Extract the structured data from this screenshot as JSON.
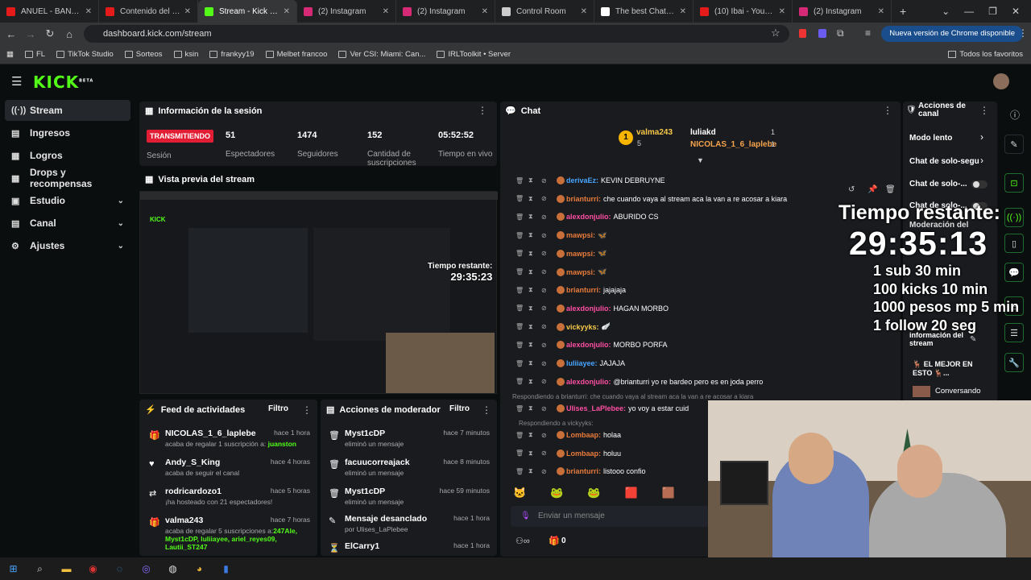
{
  "browser": {
    "tabs": [
      {
        "title": "ANUEL - BANDOL",
        "color": "#e51b1b"
      },
      {
        "title": "Contenido del canal",
        "color": "#e51b1b"
      },
      {
        "title": "Stream - Kick Dashbo",
        "color": "#53fc18",
        "active": true
      },
      {
        "title": "(2) Instagram",
        "color": "#d62976"
      },
      {
        "title": "(2) Instagram",
        "color": "#d62976"
      },
      {
        "title": "Control Room",
        "color": "#cccccc"
      },
      {
        "title": "The best ChatBot an",
        "color": "#ffffff"
      },
      {
        "title": "(10) Ibai - YouTube",
        "color": "#e51b1b"
      },
      {
        "title": "(2) Instagram",
        "color": "#d62976"
      }
    ],
    "url": "dashboard.kick.com/stream",
    "update_button": "Nueva versión de Chrome disponible",
    "bookmarks": [
      "FL",
      "TikTok Studio",
      "Sorteos",
      "ksin",
      "frankyy19",
      "Melbet francoo",
      "Ver CSI: Miami: Can...",
      "IRLToolkit • Server"
    ],
    "bookmarks_right": "Todos los favoritos"
  },
  "logo": "KICK",
  "logo_beta": "BETA",
  "sidebar": [
    {
      "label": "Stream",
      "icon": "stream-icon"
    },
    {
      "label": "Ingresos",
      "icon": "ingresos-icon"
    },
    {
      "label": "Logros",
      "icon": "logros-icon"
    },
    {
      "label": "Drops y recompensas",
      "icon": "drops-icon"
    },
    {
      "label": "Estudio",
      "icon": "estudio-icon"
    },
    {
      "label": "Canal",
      "icon": "canal-icon"
    },
    {
      "label": "Ajustes",
      "icon": "ajustes-icon"
    }
  ],
  "session": {
    "title": "Información de la sesión",
    "live_badge": "TRANSMITIENDO",
    "live_label": "Sesión",
    "stats": [
      {
        "value": "51",
        "label": "Espectadores"
      },
      {
        "value": "1474",
        "label": "Seguidores"
      },
      {
        "value": "152",
        "label": "Cantidad de suscripciones"
      },
      {
        "value": "05:52:52",
        "label": "Tiempo en vivo"
      }
    ]
  },
  "preview": {
    "title": "Vista previa del stream"
  },
  "feed": {
    "title": "Feed de actividades",
    "filter": "Filtro",
    "items": [
      {
        "name": "NICOLAS_1_6_laplebe",
        "time": "hace 1 hora",
        "text": "acaba de regalar 1 suscripción a: ",
        "highlight": "juanston"
      },
      {
        "name": "Andy_S_King",
        "time": "hace 4 horas",
        "text": "acaba de seguir el canal",
        "highlight": ""
      },
      {
        "name": "rodricardozo1",
        "time": "hace 5 horas",
        "text": "¡ha hosteado con 21 espectadores!",
        "highlight": ""
      },
      {
        "name": "valma243",
        "time": "hace 7 horas",
        "text": "acaba de regalar 5 suscripciones a:",
        "highlight": "247Ale, Myst1cDP, luliiayee, ariel_reyes09, Lautii_ST247"
      }
    ]
  },
  "mod_actions": {
    "title": "Acciones de moderador",
    "filter": "Filtro",
    "items": [
      {
        "name": "Myst1cDP",
        "time": "hace 7 minutos",
        "text": "eliminó un mensaje"
      },
      {
        "name": "facuucorreajack",
        "time": "hace 8 minutos",
        "text": "eliminó un mensaje"
      },
      {
        "name": "Myst1cDP",
        "time": "hace 59 minutos",
        "text": "eliminó un mensaje"
      },
      {
        "name": "Mensaje desanclado",
        "time": "hace 1 hora",
        "text": "por Ulises_LaPlebee"
      },
      {
        "name": "ElCarry1",
        "time": "hace 1 hora",
        "text": ""
      }
    ]
  },
  "chat": {
    "title": "Chat",
    "top_gifters": [
      {
        "name": "valma243",
        "count": "5",
        "rank": "1"
      },
      {
        "name": "luliakd",
        "count": "1"
      },
      {
        "name": "NICOLAS_1_6_laplebe",
        "count": "1"
      }
    ],
    "messages": [
      {
        "user": "derivaEz:",
        "color": "blue",
        "text": "KEVIN DEBRUYNE"
      },
      {
        "user": "brianturri:",
        "color": "orange",
        "text": "che cuando vaya al stream aca la van a re acosar a kiara"
      },
      {
        "user": "alexdonjulio:",
        "color": "pink",
        "text": "ABURIDO CS"
      },
      {
        "user": "mawpsi:",
        "color": "orange",
        "text": "🦋"
      },
      {
        "user": "mawpsi:",
        "color": "orange",
        "text": "🦋"
      },
      {
        "user": "mawpsi:",
        "color": "orange",
        "text": "🦋"
      },
      {
        "user": "brianturri:",
        "color": "orange",
        "text": "jajajaja"
      },
      {
        "user": "alexdonjulio:",
        "color": "pink",
        "text": "HAGAN MORBO"
      },
      {
        "user": "vickyyks:",
        "color": "yel",
        "text": "🪽"
      },
      {
        "user": "alexdonjulio:",
        "color": "pink",
        "text": "MORBO PORFA"
      },
      {
        "user": "luliiayee:",
        "color": "blue",
        "text": "JAJAJA"
      },
      {
        "user": "alexdonjulio:",
        "color": "pink",
        "text": "@brianturri yo re bardeo pero es en joda perro"
      }
    ],
    "reply1": "Respondiendo a brianturri: che cuando vaya al stream aca la van a re acosar a kiara",
    "reply_msg": {
      "user": "Ulises_LaPlebee:",
      "text": "yo voy a estar cuid"
    },
    "reply2": "Respondiendo a vickyyks:",
    "messages2": [
      {
        "user": "Lombaap:",
        "text": "holaa"
      },
      {
        "user": "Lombaap:",
        "text": "holuu"
      },
      {
        "user": "brianturri:",
        "text": "listooo confio"
      }
    ],
    "input_placeholder": "Enviar un mensaje",
    "counter": "0"
  },
  "overlay": {
    "title": "Tiempo restante:",
    "timer": "29:35:13",
    "lines": [
      "1 sub 30 min",
      "100 kicks 10 min",
      "1000 pesos mp 5 min",
      "1 follow 20 seg"
    ]
  },
  "actions": {
    "title": "Acciones de canal",
    "items": [
      "Modo lento",
      "Chat de solo-segu",
      "Chat de solo-...",
      "Chat de solo-..."
    ],
    "moderation": "Moderación del",
    "info": "información del stream",
    "stream_title": "🦌 EL MEJOR EN ESTO 🦌...",
    "category": "Conversando"
  }
}
